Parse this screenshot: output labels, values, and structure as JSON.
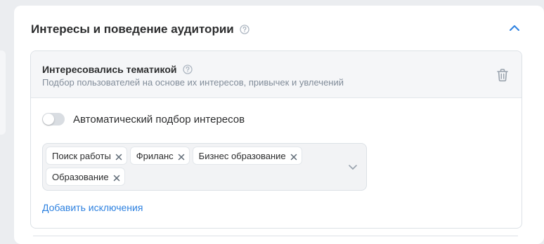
{
  "card": {
    "title": "Интересы и поведение аудитории",
    "help_icon": "help-circle-icon",
    "collapse_icon": "chevron-up-icon"
  },
  "section": {
    "title": "Интересовались тематикой",
    "subtitle": "Подбор пользователей на основе их интересов, привычек и увлечений",
    "delete_icon": "trash-icon",
    "toggle": {
      "label": "Автоматический подбор интересов",
      "enabled": false
    },
    "tags": [
      {
        "label": "Поиск работы"
      },
      {
        "label": "Фриланс"
      },
      {
        "label": "Бизнес образование"
      },
      {
        "label": "Образование"
      }
    ],
    "add_exclusions": "Добавить исключения"
  },
  "colors": {
    "accent": "#2d81e0",
    "text": "#2c2d2e",
    "secondary": "#818c99"
  }
}
